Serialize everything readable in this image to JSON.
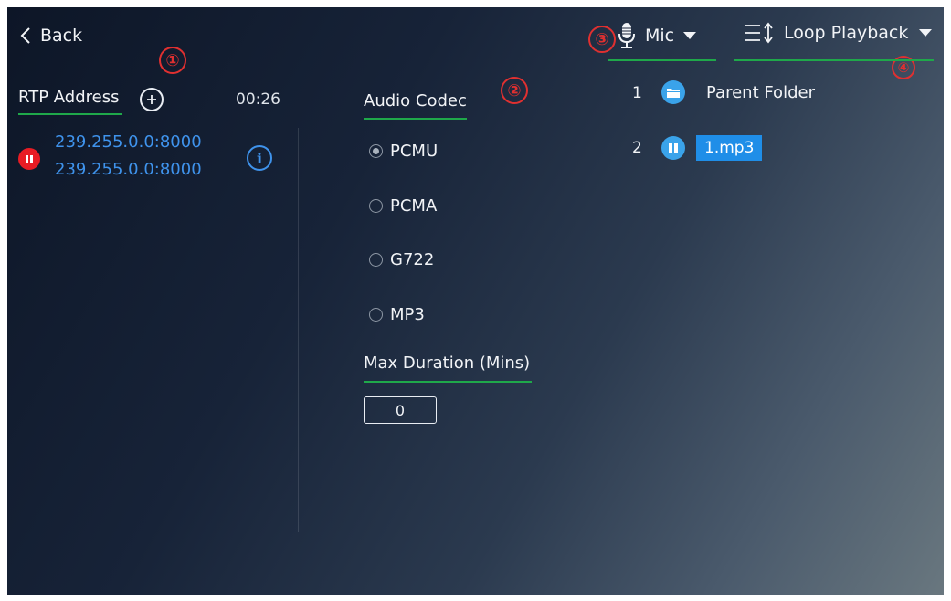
{
  "header": {
    "back_label": "Back",
    "source_label": "Mic",
    "playback_mode_label": "Loop Playback"
  },
  "callouts": [
    "①",
    "②",
    "③",
    "④"
  ],
  "rtp": {
    "title": "RTP Address",
    "timer": "00:26",
    "address_line1": "239.255.0.0:8000",
    "address_line2": "239.255.0.0:8000"
  },
  "codec": {
    "title": "Audio Codec",
    "selected": "PCMU",
    "options": [
      "PCMU",
      "PCMA",
      "G722",
      "MP3"
    ],
    "max_duration_label": "Max Duration (Mins)",
    "max_duration_value": "0"
  },
  "files": {
    "items": [
      {
        "index": "1",
        "name": "Parent Folder",
        "icon": "folder-icon"
      },
      {
        "index": "2",
        "name": "1.mp3",
        "icon": "pause-icon",
        "selected": true
      }
    ]
  },
  "colors": {
    "accent_blue": "#3f93ec",
    "underline_green": "#1fa84a",
    "callout_red": "#e03030",
    "stop_red": "#e81c24"
  }
}
